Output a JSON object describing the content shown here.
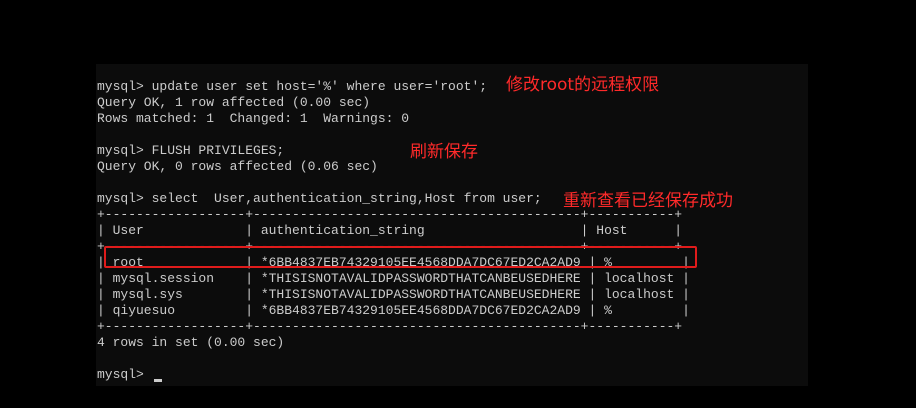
{
  "terminal": {
    "lines": [
      "mysql> update user set host='%' where user='root';",
      "Query OK, 1 row affected (0.00 sec)",
      "Rows matched: 1  Changed: 1  Warnings: 0",
      "",
      "mysql> FLUSH PRIVILEGES;",
      "Query OK, 0 rows affected (0.06 sec)",
      "",
      "mysql> select  User,authentication_string,Host from user;",
      "+------------------+------------------------------------------+-----------+",
      "| User             | authentication_string                    | Host      |",
      "+------------------+------------------------------------------+-----------+",
      "| root             | *6BB4837EB74329105EE4568DDA7DC67ED2CA2AD9 | %         |",
      "| mysql.session    | *THISISNOTAVALIDPASSWORDTHATCANBEUSEDHERE | localhost |",
      "| mysql.sys        | *THISISNOTAVALIDPASSWORDTHATCANBEUSEDHERE | localhost |",
      "| qiyuesuo         | *6BB4837EB74329105EE4568DDA7DC67ED2CA2AD9 | %         |",
      "+------------------+------------------------------------------+-----------+",
      "4 rows in set (0.00 sec)",
      "",
      "mysql> "
    ]
  },
  "annotations": {
    "update_note": "修改root的远程权限",
    "flush_note": "刷新保存",
    "select_note": "重新查看已经保存成功"
  },
  "colors": {
    "terminal_bg": "#0c0c0c",
    "terminal_text": "#cccccc",
    "annotation": "#ff2a2a",
    "highlight_border": "#e01b1b"
  }
}
